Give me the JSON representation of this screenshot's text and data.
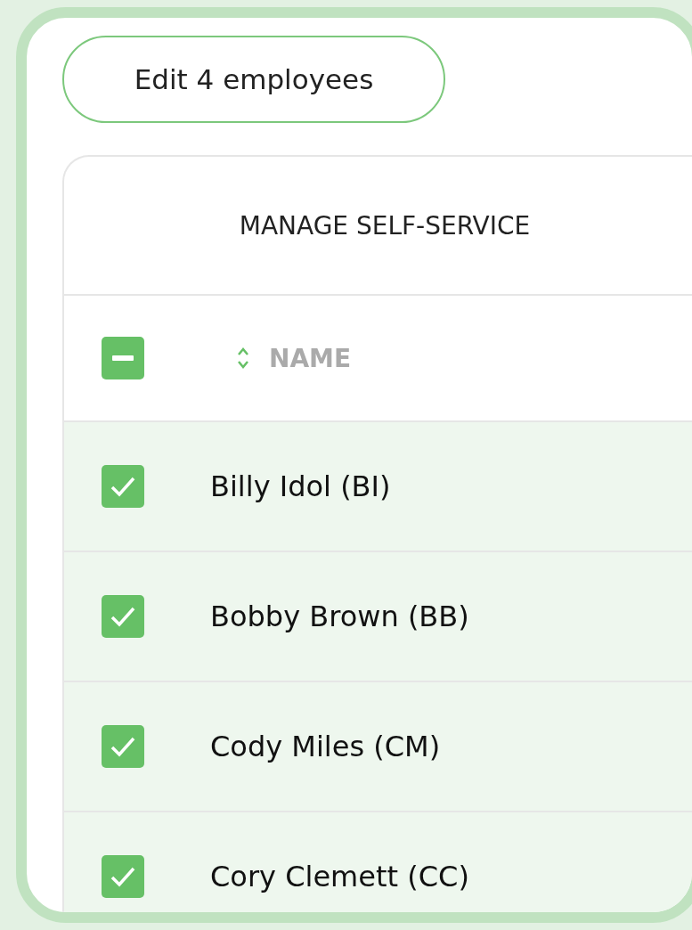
{
  "edit_button": {
    "label": "Edit 4 employees"
  },
  "table": {
    "title": "MANAGE SELF-SERVICE",
    "select_all": {
      "indeterminate": true
    },
    "columns": [
      {
        "label": "NAME",
        "sortable": true
      }
    ],
    "rows": [
      {
        "name": "Billy Idol (BI)",
        "checked": true
      },
      {
        "name": "Bobby Brown (BB)",
        "checked": true
      },
      {
        "name": "Cody Miles (CM)",
        "checked": true
      },
      {
        "name": "Cory Clemett (CC)",
        "checked": true
      }
    ]
  }
}
